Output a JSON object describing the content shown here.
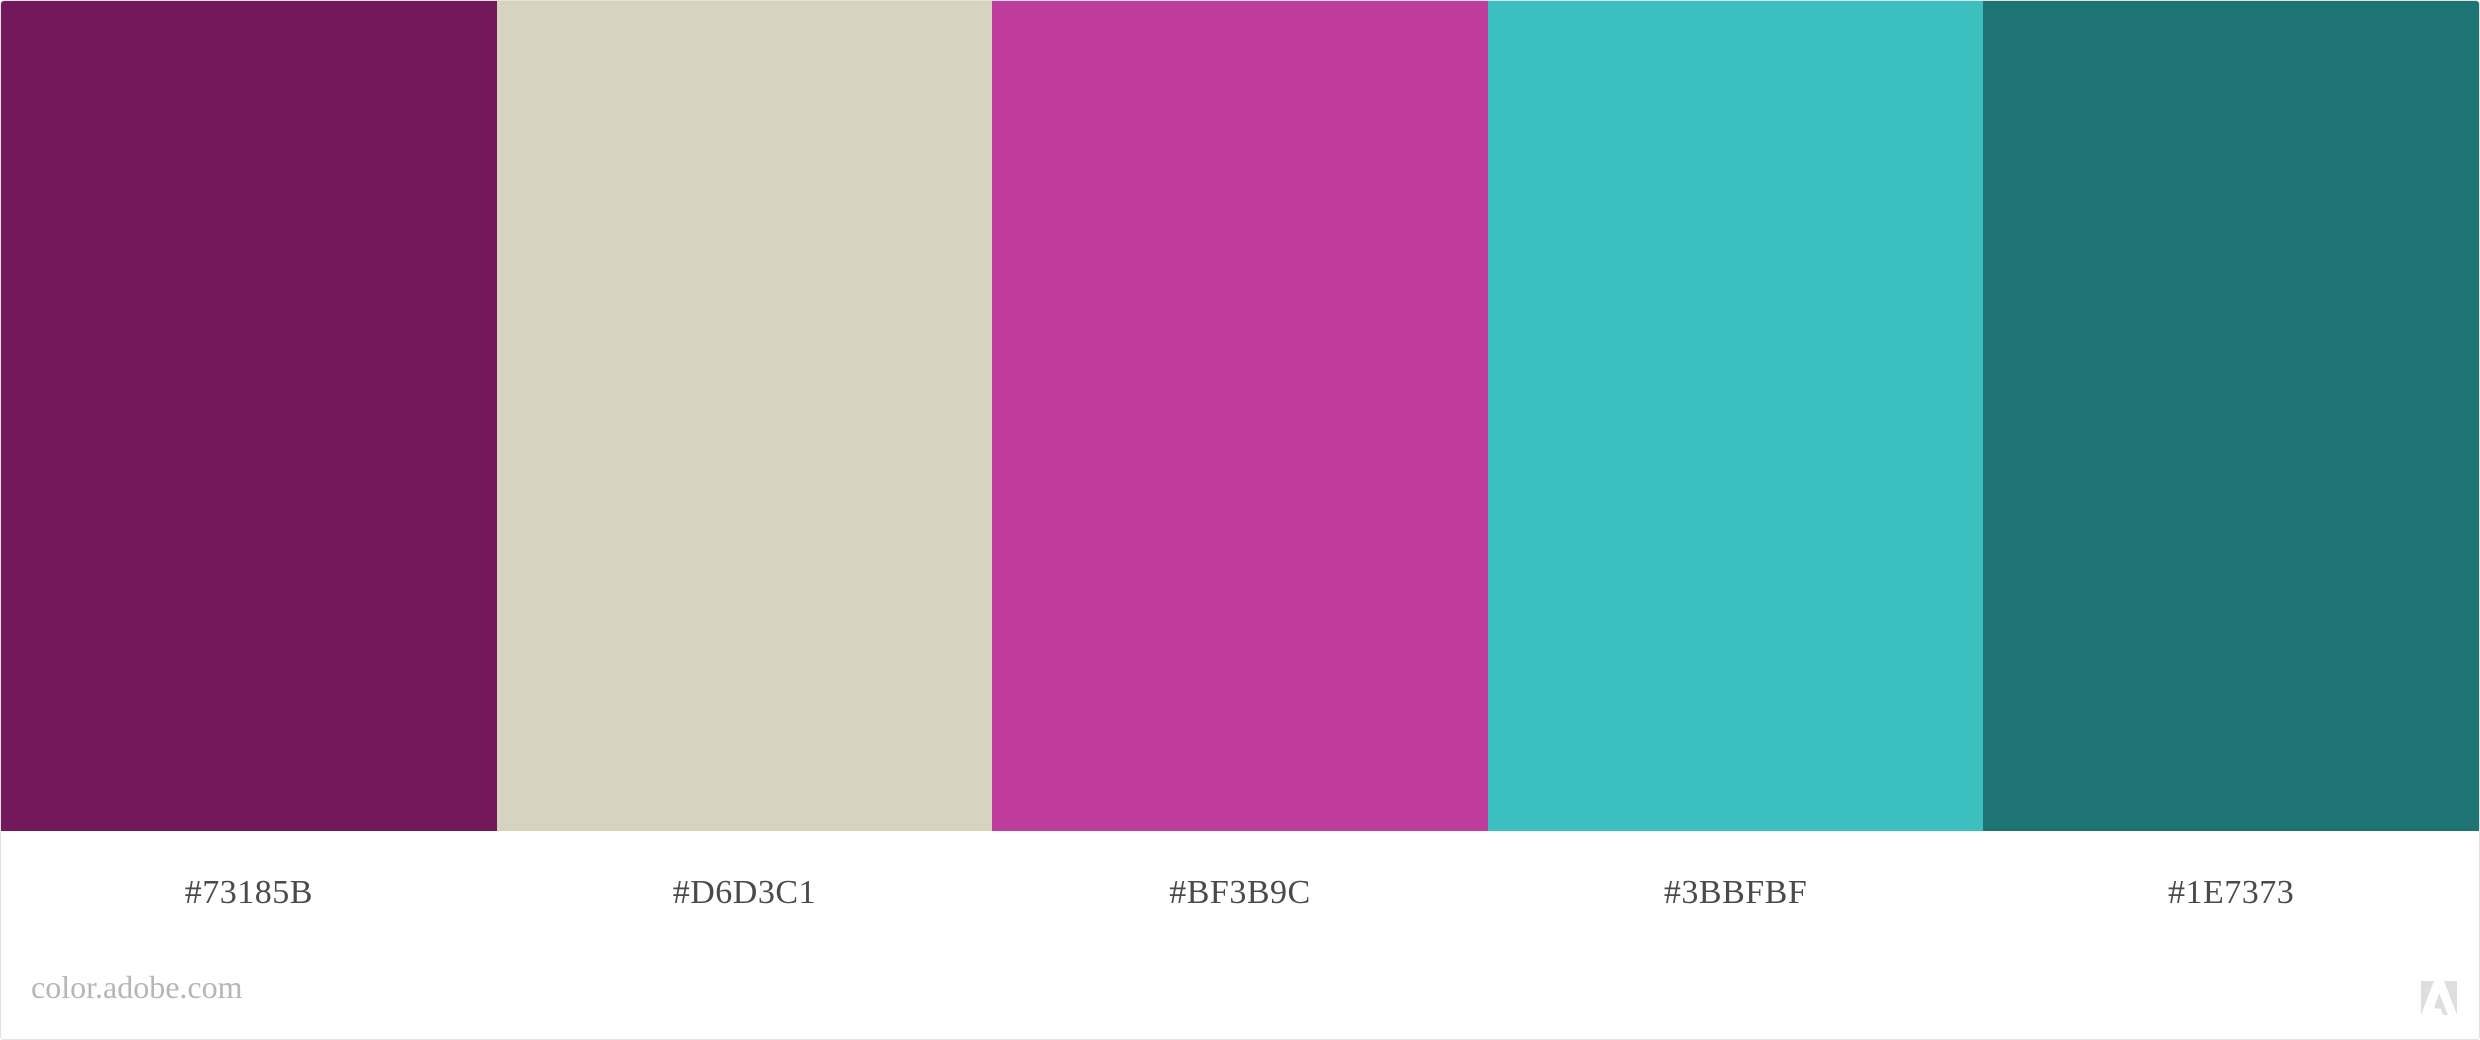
{
  "palette": {
    "swatches": [
      {
        "color": "#73185B",
        "label": "#73185B"
      },
      {
        "color": "#D6D3C1",
        "label": "#D6D3C1"
      },
      {
        "color": "#BF3B9C",
        "label": "#BF3B9C"
      },
      {
        "color": "#3BBFBF",
        "label": "#3BBFBF"
      },
      {
        "color": "#1E7373",
        "label": "#1E7373"
      }
    ]
  },
  "footer": {
    "source": "color.adobe.com",
    "logo_icon": "adobe-logo-icon",
    "logo_color": "#dedede"
  }
}
